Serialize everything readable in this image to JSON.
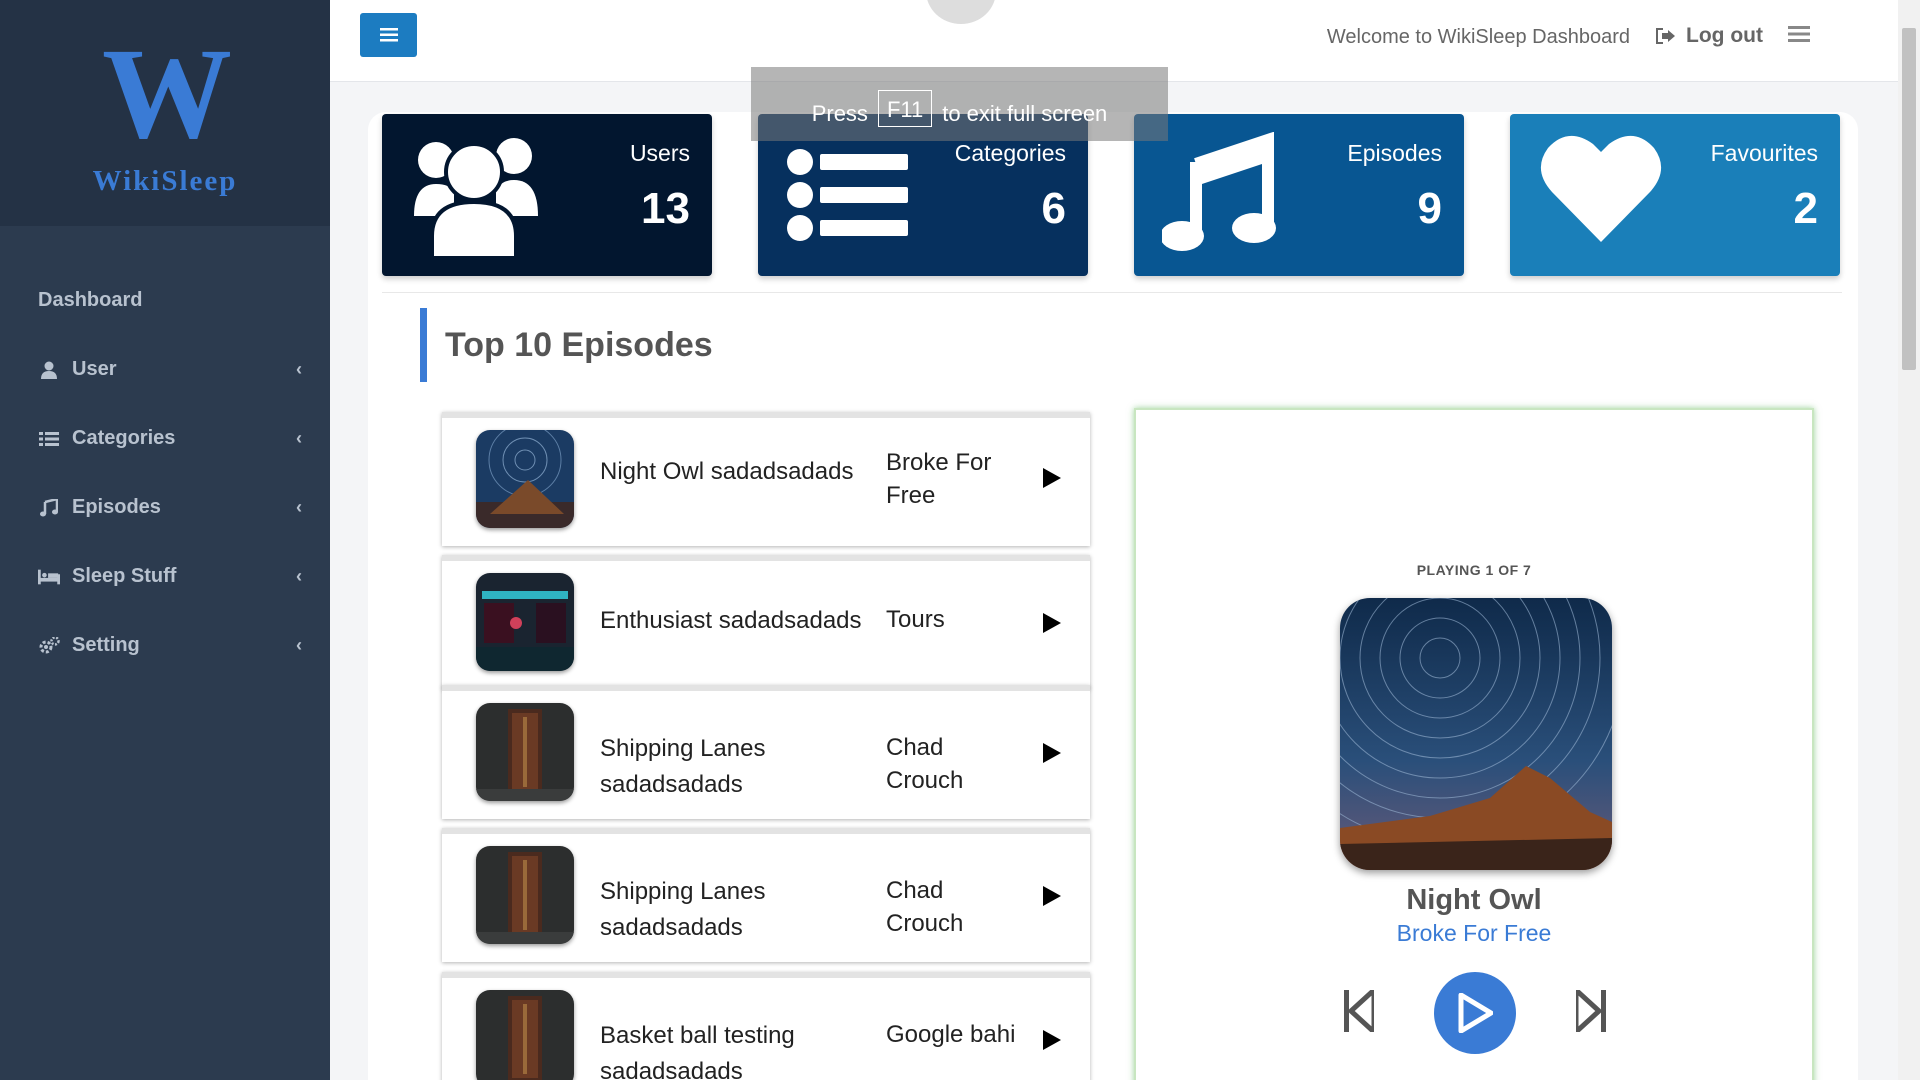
{
  "sidebar": {
    "logo_letter": "W",
    "logo_name": "WikiSleep",
    "items": [
      {
        "label": "Dashboard"
      },
      {
        "label": "User"
      },
      {
        "label": "Categories"
      },
      {
        "label": "Episodes"
      },
      {
        "label": "Sleep Stuff"
      },
      {
        "label": "Setting"
      }
    ]
  },
  "header": {
    "welcome": "Welcome to WikiSleep Dashboard",
    "logout": "Log out"
  },
  "overlay": {
    "press": "Press",
    "key": "F11",
    "suffix": "to exit full screen"
  },
  "stats": [
    {
      "title": "Users",
      "value": "13",
      "icon": "users-icon",
      "color": "#02162f"
    },
    {
      "title": "Categories",
      "value": "6",
      "icon": "list-icon",
      "color": "#06305e"
    },
    {
      "title": "Episodes",
      "value": "9",
      "icon": "music-icon",
      "color": "#085692"
    },
    {
      "title": "Favourites",
      "value": "2",
      "icon": "heart-icon",
      "color": "#1a7fb9"
    }
  ],
  "section": {
    "title": "Top 10 Episodes"
  },
  "episodes": [
    {
      "name": "Night Owl sadadsadads",
      "artist": "Broke For Free"
    },
    {
      "name": "Enthusiast sadadsadads",
      "artist": "Tours"
    },
    {
      "name": "Shipping Lanes sadadsadads",
      "artist": "Chad Crouch"
    },
    {
      "name": "Shipping Lanes sadadsadads",
      "artist": "Chad Crouch"
    },
    {
      "name": "Basket ball testing sadadsadads",
      "artist": "Google bahi"
    }
  ],
  "player": {
    "status": "PLAYING 1 OF 7",
    "title": "Night Owl",
    "artist": "Broke For Free"
  },
  "colors": {
    "accent": "#3a7bd5",
    "sidebar": "#2c3b4f",
    "menu_button": "#1c7cc1"
  }
}
